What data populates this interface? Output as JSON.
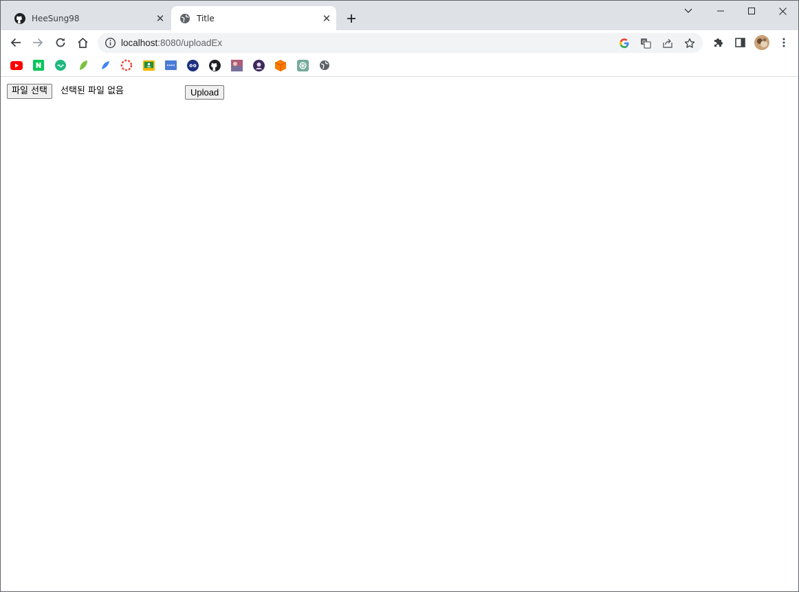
{
  "tabs": [
    {
      "title": "HeeSung98",
      "icon": "github-icon",
      "active": false
    },
    {
      "title": "Title",
      "icon": "globe-icon",
      "active": true
    }
  ],
  "toolbar": {
    "url_host": "localhost",
    "url_path": ":8080/uploadEx"
  },
  "bookmarks": [
    {
      "icon": "youtube-icon",
      "color": "#ff0000"
    },
    {
      "icon": "naver-icon",
      "color": "#03c75a"
    },
    {
      "icon": "green-circle-icon",
      "color": "#1fb981"
    },
    {
      "icon": "leaf-icon",
      "color": "#7cc242"
    },
    {
      "icon": "feather-icon",
      "color": "#4285f4"
    },
    {
      "icon": "lifebuoy-icon",
      "color": "#ea4335"
    },
    {
      "icon": "classroom-icon",
      "color": "#f4b400"
    },
    {
      "icon": "blue-bar-icon",
      "color": "#4a7bd6"
    },
    {
      "icon": "owl-icon",
      "color": "#1c2f80"
    },
    {
      "icon": "github-icon",
      "color": "#202124"
    },
    {
      "icon": "photo-icon",
      "color": "#b05b7a"
    },
    {
      "icon": "avatar-circle-icon",
      "color": "#3d2a5b"
    },
    {
      "icon": "orange-box-icon",
      "color": "#f57c00"
    },
    {
      "icon": "chatgpt-icon",
      "color": "#74aa9c"
    },
    {
      "icon": "globe-icon",
      "color": "#5f6368"
    }
  ],
  "page": {
    "file_button_label": "파일 선택",
    "file_status": "선택된 파일 없음",
    "upload_label": "Upload"
  }
}
